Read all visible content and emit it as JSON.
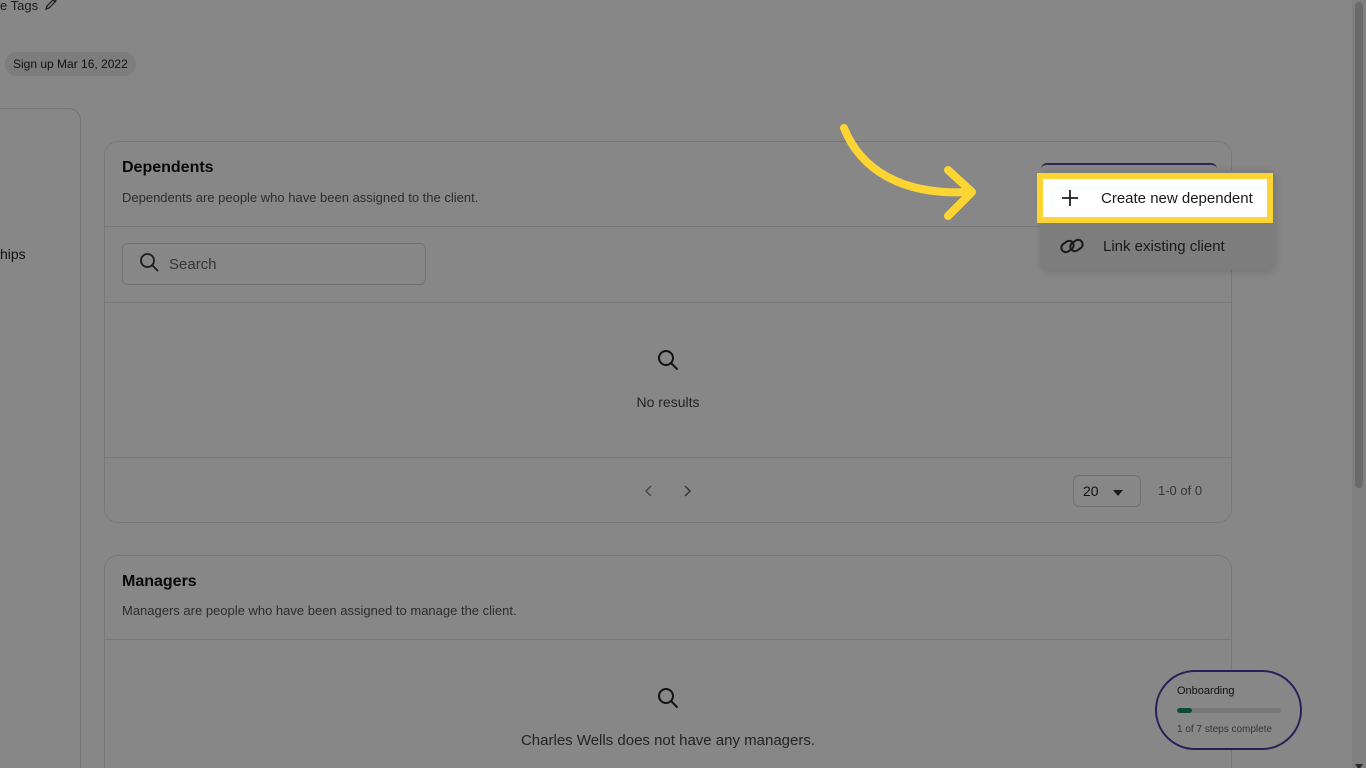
{
  "header": {
    "tags_label": "e Tags",
    "signup_badge": "Sign up Mar 16, 2022"
  },
  "left_panel": {
    "partial_label": "hips"
  },
  "dependents": {
    "title": "Dependents",
    "description": "Dependents are people who have been assigned to the client.",
    "search_placeholder": "Search",
    "empty_message": "No results",
    "per_page": "20",
    "range": "1-0 of 0"
  },
  "managers": {
    "title": "Managers",
    "description": "Managers are people who have been assigned to manage the client.",
    "empty_message": "Charles Wells does not have any managers."
  },
  "dropdown": {
    "items": [
      {
        "label": "Create new dependent",
        "icon": "plus-icon"
      },
      {
        "label": "Link existing client",
        "icon": "link-icon"
      }
    ]
  },
  "onboarding": {
    "title": "Onboarding",
    "steps_text": "1 of 7 steps complete",
    "progress": 0.143
  },
  "colors": {
    "highlight": "#fcd535",
    "accent": "#4b3ca6",
    "progress": "#1f8a67"
  }
}
